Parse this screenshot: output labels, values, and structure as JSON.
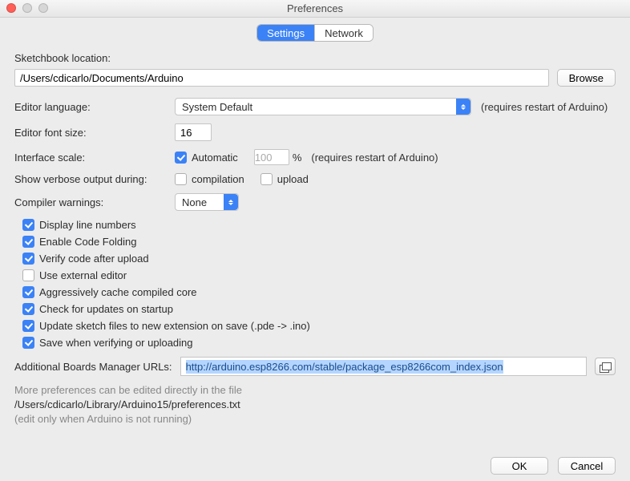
{
  "window": {
    "title": "Preferences"
  },
  "tabs": {
    "settings": "Settings",
    "network": "Network"
  },
  "labels": {
    "sketchbook": "Sketchbook location:",
    "editorLanguage": "Editor language:",
    "editorFontSize": "Editor font size:",
    "interfaceScale": "Interface scale:",
    "verboseOutput": "Show verbose output during:",
    "compilerWarnings": "Compiler warnings:",
    "additionalBoards": "Additional Boards Manager URLs:",
    "restartHint": "(requires restart of Arduino)",
    "automatic": "Automatic",
    "percent": "%",
    "compilation": "compilation",
    "upload": "upload"
  },
  "values": {
    "sketchbookPath": "/Users/cdicarlo/Documents/Arduino",
    "editorLanguage": "System Default",
    "editorFontSize": "16",
    "interfaceScale": "100",
    "compilerWarnings": "None",
    "boardsUrl": "http://arduino.esp8266.com/stable/package_esp8266com_index.json",
    "preferencesPath": "/Users/cdicarlo/Library/Arduino15/preferences.txt"
  },
  "buttons": {
    "browse": "Browse",
    "ok": "OK",
    "cancel": "Cancel"
  },
  "checkboxes": {
    "automatic": true,
    "compilation": false,
    "upload": false,
    "displayLineNumbers": {
      "checked": true,
      "label": "Display line numbers"
    },
    "enableCodeFolding": {
      "checked": true,
      "label": "Enable Code Folding"
    },
    "verifyAfterUpload": {
      "checked": true,
      "label": "Verify code after upload"
    },
    "externalEditor": {
      "checked": false,
      "label": "Use external editor"
    },
    "aggressiveCache": {
      "checked": true,
      "label": "Aggressively cache compiled core"
    },
    "checkUpdates": {
      "checked": true,
      "label": "Check for updates on startup"
    },
    "updateExtension": {
      "checked": true,
      "label": "Update sketch files to new extension on save (.pde -> .ino)"
    },
    "saveOnVerify": {
      "checked": true,
      "label": "Save when verifying or uploading"
    }
  },
  "footer": {
    "line1": "More preferences can be edited directly in the file",
    "line3": "(edit only when Arduino is not running)"
  }
}
